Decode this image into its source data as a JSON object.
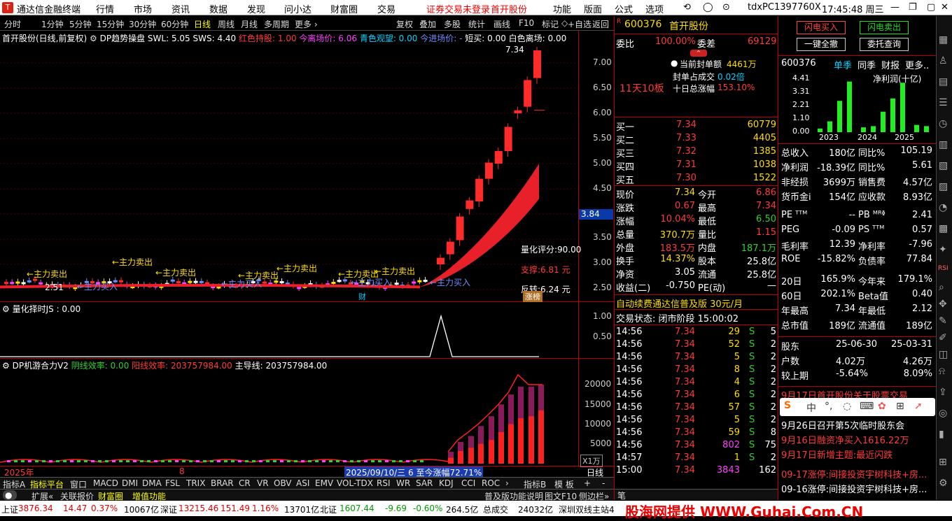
{
  "titlebar": {
    "app": "通达信金融终端",
    "menu": [
      "行情",
      "市场",
      "资讯",
      "数据",
      "发现",
      "问小达",
      "财富圈",
      "交易"
    ],
    "notice": "证券交易未登录",
    "stock": "首开股份",
    "right_menu": [
      "功能",
      "版面",
      "公式",
      "选项"
    ],
    "user": "tdxPC1397760X",
    "time": "17:45:48 周三"
  },
  "periods": [
    "分时",
    "1分钟",
    "5分钟",
    "15分钟",
    "30分钟",
    "60分钟",
    "日线",
    "周线",
    "月线",
    "多周期",
    "更多 ›"
  ],
  "tools": [
    "复权",
    "叠加",
    "多股",
    "统计",
    "画线",
    "F10",
    "标记"
  ],
  "add_fav": "+自选",
  "back": "返回",
  "main_legend": {
    "name": "首开股份(日线,前复权)",
    "ind": "DP趋势操盘",
    "swl": "SWL: 5.05",
    "sws": "SWS: 4.40",
    "hold": "红色持股: 1.00",
    "leave": "今离场价: 6.06",
    "watch": "青色观望: 0.00",
    "enter": "今进场价: -",
    "tmp": "短买: 0.00",
    "white": "白色离场: 0.00"
  },
  "price_axis": [
    "7.00",
    "6.50",
    "6.00",
    "5.50",
    "5.00",
    "4.50",
    "4.00",
    "3.50",
    "3.00",
    "2.50"
  ],
  "price_tag": "3.84",
  "high_label": "7.34",
  "low_label": "2.51",
  "annotations": {
    "score": "量化评分:90.00",
    "support": "支撑:6.81 元",
    "reverse": "反转:6.24 元",
    "zt": "涨榜",
    "cai": "财"
  },
  "arrows": [
    "←主力卖出",
    "←主力卖出",
    "←主力卖出",
    "←主力卖出",
    "←主力卖出",
    "←主力卖出",
    "←主力卖出",
    "←主力买入",
    "←主力买入",
    "←主力买入",
    "←主力买入"
  ],
  "sub1": {
    "name": "量化择时JS : 0.00",
    "axis": [
      "1.00",
      "0.50"
    ]
  },
  "sub2": {
    "name": "DP机游合力V2",
    "yin": "阴线效率: 0.00",
    "yang": "阳线效率: 203757984.00",
    "main": "主导线: 203757984.00",
    "axis": [
      "20000",
      "15000",
      "10000",
      "5000"
    ],
    "unit": "X1万"
  },
  "date_bar": {
    "year": "2025年",
    "month": "8",
    "hover": "2025/09/10/三 6 至今涨幅72.71%",
    "label": "日线"
  },
  "ind_tabs": [
    "指标A",
    "指标平台",
    "窗口",
    "MACD",
    "DMI",
    "DMA",
    "FSL",
    "TRIX",
    "BRAR",
    "CR",
    "VR",
    "OBV",
    "ASI",
    "EMV",
    "VOL-TDX",
    "RSI",
    "WR",
    "SAR",
    "KDJ",
    "CCI",
    "ROC",
    "›",
    "指标B",
    "模 板",
    "+",
    "-"
  ],
  "bottom_tabs": [
    "扩展«",
    "关联报价",
    "财富圈",
    "增值功能"
  ],
  "bottom_right": [
    "普及版功能说明",
    "图文F10",
    "侧边栏»"
  ],
  "status": {
    "sh_label": "上证",
    "sh": "3876.34",
    "sh_chg": "14.47",
    "sh_pct": "0.37%",
    "sh_amt": "10067亿",
    "sz_label": "深证",
    "sz": "13215.46",
    "sz_chg": "151.49",
    "sz_pct": "1.16%",
    "sz_amt": "13701亿",
    "bz_label": "北证",
    "bz": "1607.44",
    "bz_chg": "-9.69",
    "bz_pct": "-0.60%",
    "bz_amt": "264.5亿",
    "total_label": "总成交",
    "total": "24032亿",
    "station": "深圳双线主站4"
  },
  "watermark": "股海网提供 WWW.Guhai.Com.CN",
  "quote": {
    "code": "600376",
    "name": "首开股份",
    "ratio_label": "委比",
    "ratio": "100.00%",
    "diff_label": "委差",
    "diff": "69129",
    "board": "11天10板",
    "seal_amt_label": "当前封单额",
    "seal_amt": "4461万",
    "seal_pct_label": "封单占成交",
    "seal_pct": "0.02倍",
    "ten_label": "十日总涨幅",
    "ten": "153.10%",
    "bids": [
      {
        "l": "买一",
        "p": "7.34",
        "v": "60779"
      },
      {
        "l": "买二",
        "p": "7.33",
        "v": "4405"
      },
      {
        "l": "买三",
        "p": "7.32",
        "v": "1385"
      },
      {
        "l": "买四",
        "p": "7.31",
        "v": "1038"
      },
      {
        "l": "买五",
        "p": "7.30",
        "v": "1522"
      }
    ],
    "stats": [
      [
        "现价",
        "7.34",
        "今开",
        "6.86"
      ],
      [
        "涨跌",
        "0.67",
        "最高",
        "7.34"
      ],
      [
        "涨幅",
        "10.04%",
        "最低",
        "6.50"
      ],
      [
        "总量",
        "370.7万",
        "量比",
        "1.15"
      ],
      [
        "外盘",
        "183.5万",
        "内盘",
        "187.1万"
      ],
      [
        "换手",
        "14.37%",
        "股本",
        "25.8亿"
      ],
      [
        "净资",
        "3.05",
        "流通",
        "25.8亿"
      ],
      [
        "收益(二)",
        "-0.750",
        "PE(动)",
        "—"
      ]
    ],
    "promo": "自动续费通达信普及版 30元/月",
    "trade_state": "交易状态: 闭市阶段 15:00:02",
    "ticks": [
      [
        "14:56",
        "7.34",
        "29",
        "S",
        "5"
      ],
      [
        "14:56",
        "7.34",
        "52",
        "S",
        "2"
      ],
      [
        "14:56",
        "7.34",
        "5",
        "S",
        "2"
      ],
      [
        "14:56",
        "7.34",
        "8",
        "S",
        "2"
      ],
      [
        "14:56",
        "7.34",
        "4",
        "S",
        "2"
      ],
      [
        "14:56",
        "7.34",
        "6",
        "S",
        "2"
      ],
      [
        "14:56",
        "7.34",
        "57",
        "S",
        "2"
      ],
      [
        "14:56",
        "7.34",
        "5",
        "S",
        "2"
      ],
      [
        "14:56",
        "7.34",
        "59",
        "S",
        "8"
      ],
      [
        "14:56",
        "7.34",
        "802",
        "S",
        "75"
      ],
      [
        "14:57",
        "7.34",
        "1",
        "S",
        "2"
      ],
      [
        "15:00",
        "7.34",
        "3843",
        "",
        "162"
      ]
    ]
  },
  "right": {
    "btn_buy": "闪电买入",
    "btn_sell": "闪电卖出",
    "btn_cancel": "一键全撤",
    "btn_query": "委托查询",
    "code": "600376",
    "tabs": [
      "单季",
      "同季",
      "财报",
      "更多.."
    ],
    "fin_title": "净利润(十亿)",
    "fin_axis": [
      "4.41",
      "3.31",
      "2.21",
      "1.10",
      "0.00"
    ],
    "fin_years": [
      "2023",
      "2024",
      "2025"
    ],
    "fin_values": [
      0.3,
      0.9,
      2.6,
      4.2,
      0.4,
      0.5,
      1.7,
      2.8,
      4.1,
      0.6,
      0.5
    ],
    "metrics": [
      [
        "总收入",
        "180亿",
        "同比%",
        "105.19"
      ],
      [
        "净利润",
        "-18.39亿",
        "同比%",
        "5.61"
      ],
      [
        "非经损",
        "3699万",
        "销售费",
        "4.57亿"
      ],
      [
        "货币金i",
        "154亿",
        "应收款",
        "8.93亿"
      ],
      [
        "PE ᵀᵀᴹ",
        "--",
        "PB ᴹᴿᶲ",
        "2.41"
      ],
      [
        "PEG",
        "-0.09",
        "PS ᵀᵀᴹ",
        "0.57"
      ],
      [
        "毛利率",
        "12.39",
        "净利率",
        "-7.96"
      ],
      [
        "ROE",
        "-15.82%",
        "负债率",
        "77.84"
      ],
      [
        "20日",
        "165.9%",
        "今年来",
        "179.1%"
      ],
      [
        "60日",
        "202.1%",
        "Beta值",
        "0.40"
      ],
      [
        "年最高",
        "7.34",
        "年最低",
        "2.12"
      ],
      [
        "总市值",
        "189亿",
        "流通值",
        "189亿"
      ]
    ],
    "holders": [
      [
        "股东",
        "25-06-30",
        "25-03-31"
      ],
      [
        "户数",
        "4.02万",
        "4.26万"
      ],
      [
        "较上期",
        "-5.64%",
        "8.09%"
      ]
    ],
    "news": [
      "9月17日首开股份关于股票交易",
      "9月26日召开第5次临时股东会",
      "9月16日融资净买入1616.22万",
      "9月17日新增主题:最近闪跌",
      "09-17涨停:间接投资宇树科技+房...",
      "09-16涨停:间接投资宇树科技+房..."
    ]
  }
}
